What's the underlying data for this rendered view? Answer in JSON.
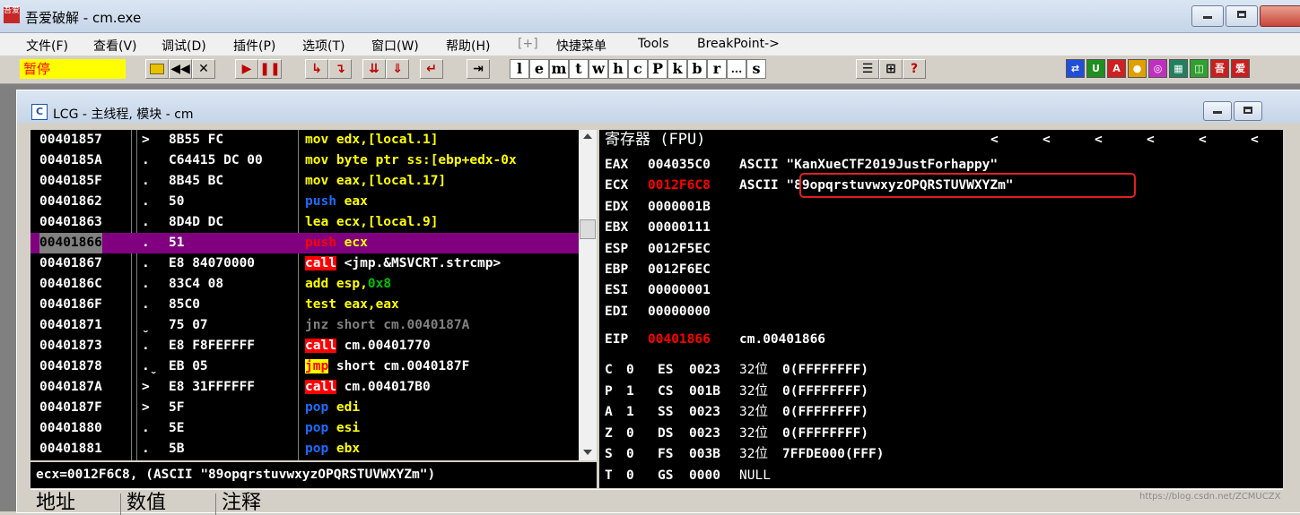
{
  "window": {
    "title": "吾爱破解 - cm.exe",
    "icon_label": "吾爱"
  },
  "menu": [
    "文件(F)",
    "查看(V)",
    "调试(D)",
    "插件(P)",
    "选项(T)",
    "窗口(W)",
    "帮助(H)",
    "[+]",
    "快捷菜单",
    "Tools",
    "BreakPoint->"
  ],
  "toolbar": {
    "status": "暂停",
    "letter_buttons": [
      "l",
      "e",
      "m",
      "t",
      "w",
      "h",
      "c",
      "P",
      "k",
      "b",
      "r",
      "...",
      "s"
    ],
    "help_label": "?"
  },
  "lcg_window": {
    "title": "LCG - 主线程, 模块 - cm",
    "icon_label": "C"
  },
  "disasm": {
    "rows": [
      {
        "addr": "00401857",
        "flag": ">",
        "hex": "8B55 FC",
        "mnem": "mov",
        "ops": " edx,[local.1]",
        "mtype": "mov"
      },
      {
        "addr": "0040185A",
        "flag": ".",
        "hex": "C64415 DC 00",
        "mnem": "mov",
        "ops": " byte ptr ss:[ebp+edx-0x",
        "mtype": "mov"
      },
      {
        "addr": "0040185F",
        "flag": ".",
        "hex": "8B45 BC",
        "mnem": "mov",
        "ops": " eax,[local.17]",
        "mtype": "mov"
      },
      {
        "addr": "00401862",
        "flag": ".",
        "hex": "50",
        "mnem": "push",
        "ops": " eax",
        "mtype": "push"
      },
      {
        "addr": "00401863",
        "flag": ".",
        "hex": "8D4D DC",
        "mnem": "lea",
        "ops": " ecx,[local.9]",
        "mtype": "mov"
      },
      {
        "addr": "00401866",
        "flag": ".",
        "hex": "51",
        "mnem": "push",
        "ops": " ecx",
        "mtype": "push",
        "current": true
      },
      {
        "addr": "00401867",
        "flag": ".",
        "hex": "E8 84070000",
        "mnem": "call",
        "ops": " <jmp.&MSVCRT.strcmp>",
        "mtype": "call"
      },
      {
        "addr": "0040186C",
        "flag": ".",
        "hex": "83C4 08",
        "mnem": "add",
        "ops": " esp,",
        "imm": "0x8",
        "mtype": "add"
      },
      {
        "addr": "0040186F",
        "flag": ".",
        "hex": "85C0",
        "mnem": "test",
        "ops": " eax,eax",
        "mtype": "mov"
      },
      {
        "addr": "00401871",
        "flag": "ˬ",
        "hex": "75 07",
        "mnem": "jnz",
        "ops": " short cm.0040187A",
        "mtype": "jcc"
      },
      {
        "addr": "00401873",
        "flag": ".",
        "hex": "E8 F8FEFFFF",
        "mnem": "call",
        "ops": " cm.00401770",
        "mtype": "call"
      },
      {
        "addr": "00401878",
        "flag": ".ˬ",
        "hex": "EB 05",
        "mnem": "jmp",
        "ops": " short cm.0040187F",
        "mtype": "jmp"
      },
      {
        "addr": "0040187A",
        "flag": ">",
        "hex": "E8 31FFFFFF",
        "mnem": "call",
        "ops": " cm.004017B0",
        "mtype": "call"
      },
      {
        "addr": "0040187F",
        "flag": ">",
        "hex": "5F",
        "mnem": "pop",
        "ops": " edi",
        "mtype": "push"
      },
      {
        "addr": "00401880",
        "flag": ".",
        "hex": "5E",
        "mnem": "pop",
        "ops": " esi",
        "mtype": "push"
      },
      {
        "addr": "00401881",
        "flag": ".",
        "hex": "5B",
        "mnem": "pop",
        "ops": " ebx",
        "mtype": "push"
      }
    ]
  },
  "registers": {
    "header": "寄存器 (FPU)",
    "arrows": [
      "<",
      "<",
      "<",
      "<",
      "<",
      "<"
    ],
    "gp": [
      {
        "name": "EAX",
        "value": "004035C0",
        "note": "ASCII \"KanXueCTF2019JustForhappy\""
      },
      {
        "name": "ECX",
        "value": "0012F6C8",
        "note": "ASCII \"89opqrstuvwxyzOPQRSTUVWXYZm\"",
        "changed": true
      },
      {
        "name": "EDX",
        "value": "0000001B",
        "note": ""
      },
      {
        "name": "EBX",
        "value": "00000111",
        "note": ""
      },
      {
        "name": "ESP",
        "value": "0012F5EC",
        "note": ""
      },
      {
        "name": "EBP",
        "value": "0012F6EC",
        "note": ""
      },
      {
        "name": "ESI",
        "value": "00000001",
        "note": ""
      },
      {
        "name": "EDI",
        "value": "00000000",
        "note": ""
      }
    ],
    "eip": {
      "name": "EIP",
      "value": "00401866",
      "note": "cm.00401866"
    },
    "flags": [
      {
        "flag": "C",
        "bit": "0",
        "seg": "ES",
        "sel": "0023",
        "width": "32位",
        "base": "0(FFFFFFFF)"
      },
      {
        "flag": "P",
        "bit": "1",
        "seg": "CS",
        "sel": "001B",
        "width": "32位",
        "base": "0(FFFFFFFF)"
      },
      {
        "flag": "A",
        "bit": "1",
        "seg": "SS",
        "sel": "0023",
        "width": "32位",
        "base": "0(FFFFFFFF)"
      },
      {
        "flag": "Z",
        "bit": "0",
        "seg": "DS",
        "sel": "0023",
        "width": "32位",
        "base": "0(FFFFFFFF)"
      },
      {
        "flag": "S",
        "bit": "0",
        "seg": "FS",
        "sel": "003B",
        "width": "32位",
        "base": "7FFDE000(FFF)"
      },
      {
        "flag": "T",
        "bit": "0",
        "seg": "GS",
        "sel": "0000",
        "width": "NULL",
        "base": ""
      }
    ]
  },
  "info_line": "ecx=0012F6C8, (ASCII \"89opqrstuvwxyzOPQRSTUVWXYZm\")",
  "dump_header": [
    "地址",
    "数值",
    "注释"
  ],
  "watermark": "https://blog.csdn.net/ZCMUCZX",
  "colors": {
    "mov_fg": "#ffff00",
    "push_fg": "#1e6bff",
    "call_bg": "#ff0000",
    "call_fg": "#ffffff",
    "jcc_fg": "#808080",
    "current_bg": "#800080",
    "changed_reg": "#ff0000",
    "highlight": "#e02020"
  }
}
